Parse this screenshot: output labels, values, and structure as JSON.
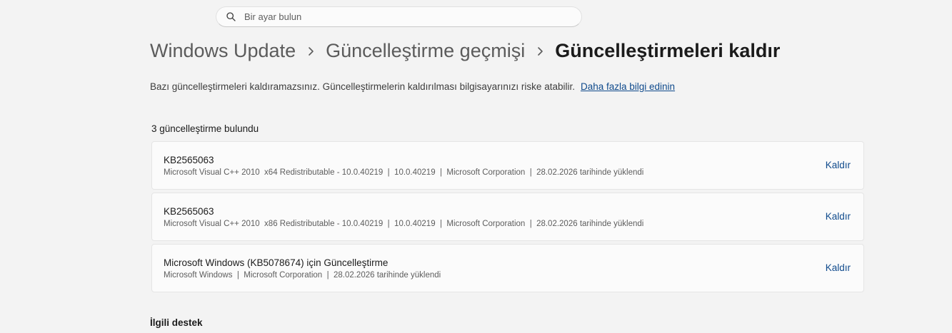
{
  "search": {
    "placeholder": "Bir ayar bulun"
  },
  "breadcrumb": {
    "items": [
      "Windows Update",
      "Güncelleştirme geçmişi"
    ],
    "current": "Güncelleştirmeleri kaldır"
  },
  "info": {
    "text": "Bazı güncelleştirmeleri kaldıramazsınız. Güncelleştirmelerin kaldırılması bilgisayarınızı riske atabilir.",
    "link": "Daha fazla bilgi edinin"
  },
  "updates": {
    "count_label": "3 güncelleştirme bulundu",
    "items": [
      {
        "title": "KB2565063",
        "meta": "Microsoft Visual C++ 2010  x64 Redistributable - 10.0.40219  |  10.0.40219  |  Microsoft Corporation  |  28.02.2026 tarihinde yüklendi",
        "action": "Kaldır"
      },
      {
        "title": "KB2565063",
        "meta": "Microsoft Visual C++ 2010  x86 Redistributable - 10.0.40219  |  10.0.40219  |  Microsoft Corporation  |  28.02.2026 tarihinde yüklendi",
        "action": "Kaldır"
      },
      {
        "title": "Microsoft Windows (KB5078674) için Güncelleştirme",
        "meta": "Microsoft Windows  |  Microsoft Corporation  |  28.02.2026 tarihinde yüklendi",
        "action": "Kaldır"
      }
    ]
  },
  "related": {
    "title": "İlgili destek"
  },
  "icons": {
    "search": "search-icon",
    "separator": "chevron-right-icon"
  },
  "colors": {
    "accent": "#0f4a8c",
    "background": "#f3f3f3",
    "card": "#fbfbfb"
  }
}
